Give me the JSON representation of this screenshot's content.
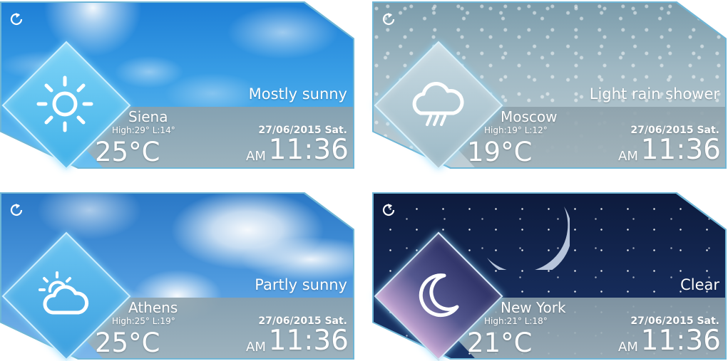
{
  "widgets": [
    {
      "condition": "Mostly sunny",
      "city": "Siena",
      "high_low": "High:29° L:14°",
      "date": "27/06/2015 Sat.",
      "temperature": "25°C",
      "ampm": "AM",
      "time": "11:36",
      "icon": "sun-icon"
    },
    {
      "condition": "Light rain shower",
      "city": "Moscow",
      "high_low": "High:19° L:12°",
      "date": "27/06/2015 Sat.",
      "temperature": "19°C",
      "ampm": "AM",
      "time": "11:36",
      "icon": "rain-cloud-icon"
    },
    {
      "condition": "Partly sunny",
      "city": "Athens",
      "high_low": "High:25° L:19°",
      "date": "27/06/2015 Sat.",
      "temperature": "25°C",
      "ampm": "AM",
      "time": "11:36",
      "icon": "partly-sunny-icon"
    },
    {
      "condition": "Clear",
      "city": "New York",
      "high_low": "High:21° L:18°",
      "date": "27/06/2015 Sat.",
      "temperature": "21°C",
      "ampm": "AM",
      "time": "11:36",
      "icon": "moon-icon"
    }
  ],
  "colors": {
    "text": "#ffffff",
    "border": "#6fb6d6",
    "strip": "#9fb2ba"
  }
}
